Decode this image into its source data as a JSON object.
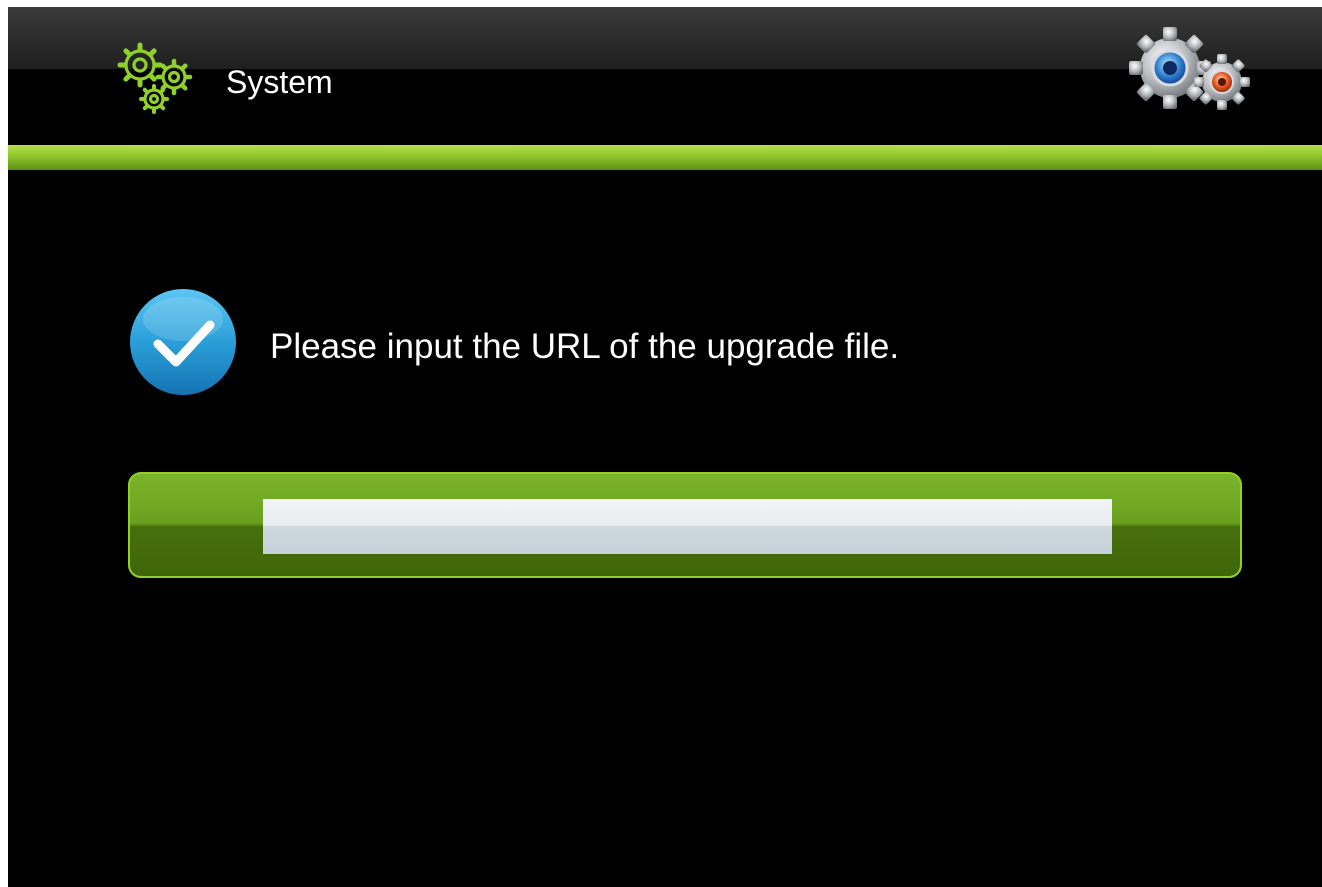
{
  "header": {
    "title": "System",
    "left_icon": "gears-icon",
    "right_icon": "settings-gears-icon"
  },
  "message": {
    "icon": "checkmark-icon",
    "text": "Please input the URL of the upgrade file."
  },
  "url_input": {
    "value": "",
    "placeholder": ""
  },
  "colors": {
    "background": "#000000",
    "accent_green": "#8fc42c",
    "check_blue": "#2a9fd8",
    "field": "#e7ebee"
  }
}
